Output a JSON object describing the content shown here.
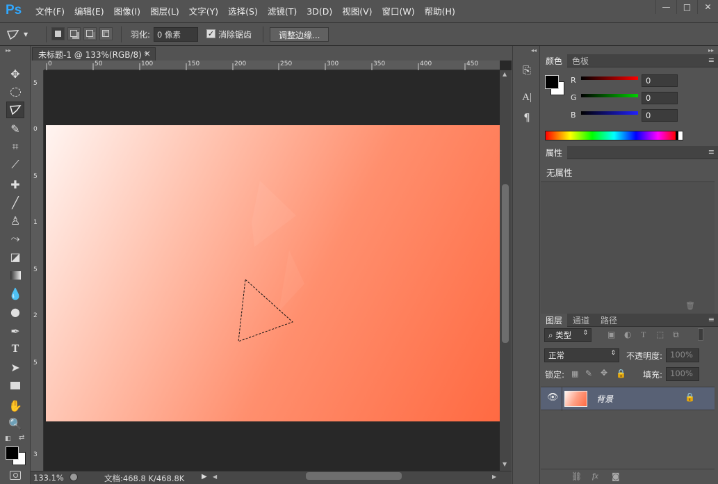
{
  "app": {
    "logo": "Ps"
  },
  "menu": [
    "文件(F)",
    "编辑(E)",
    "图像(I)",
    "图层(L)",
    "文字(Y)",
    "选择(S)",
    "滤镜(T)",
    "3D(D)",
    "视图(V)",
    "窗口(W)",
    "帮助(H)"
  ],
  "window_buttons": {
    "minimize": "—",
    "restore": "□",
    "close": "✕"
  },
  "options": {
    "feather_label": "羽化:",
    "feather_value": "0 像素",
    "antialias_label": "消除锯齿",
    "antialias_checked": "✓",
    "refine_edge_label": "调整边缘..."
  },
  "document": {
    "tab_title": "未标题-1 @ 133%(RGB/8) *",
    "tab_close": "×"
  },
  "ruler": {
    "h_ticks": [
      "0",
      "50",
      "100",
      "150",
      "200",
      "250",
      "300",
      "350",
      "400",
      "450"
    ],
    "v_ticks": [
      "5",
      "0",
      "5",
      "1",
      "5",
      "2",
      "5",
      "3"
    ]
  },
  "status": {
    "zoom": "133.1%",
    "doc_info": "文档:468.8 K/468.8K"
  },
  "color_panel": {
    "tabs": [
      "颜色",
      "色板"
    ],
    "r_label": "R",
    "g_label": "G",
    "b_label": "B",
    "r_value": "0",
    "g_value": "0",
    "b_value": "0"
  },
  "properties_panel": {
    "tab": "属性",
    "text": "无属性"
  },
  "layers_panel": {
    "tabs": [
      "图层",
      "通道",
      "路径"
    ],
    "filter_label": "类型",
    "blend_mode": "正常",
    "opacity_label": "不透明度:",
    "opacity_value": "100%",
    "lock_label": "锁定:",
    "fill_label": "填充:",
    "fill_value": "100%",
    "layer_name": "背景"
  },
  "colors": {
    "foreground": "#000000",
    "background": "#ffffff",
    "accent": "#31a8ff"
  }
}
